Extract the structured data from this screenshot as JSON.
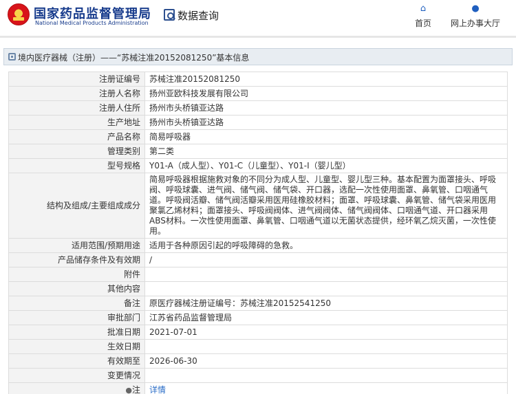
{
  "header": {
    "logo_cn": "国家药品监督管理局",
    "logo_en": "National Medical Products Administration",
    "module_title": "数据查询",
    "nav": [
      {
        "label": "首页",
        "icon": "home-icon"
      },
      {
        "label": "网上办事大厅",
        "icon": "user-icon"
      }
    ]
  },
  "breadcrumb": {
    "text": "境内医疗器械（注册）——“苏械注准20152081250”基本信息"
  },
  "details": {
    "rows": [
      {
        "label": "注册证编号",
        "value": "苏械注准20152081250"
      },
      {
        "label": "注册人名称",
        "value": "扬州亚欧科技发展有限公司"
      },
      {
        "label": "注册人住所",
        "value": "扬州市头桥镇亚达路"
      },
      {
        "label": "生产地址",
        "value": "扬州市头桥镇亚达路"
      },
      {
        "label": "产品名称",
        "value": "简易呼吸器"
      },
      {
        "label": "管理类别",
        "value": "第二类"
      },
      {
        "label": "型号规格",
        "value": "Y01-A（成人型）、Y01-C（儿童型）、Y01-I（婴儿型）"
      },
      {
        "label": "结构及组成/主要组成成分",
        "value": "简易呼吸器根据施救对象的不同分为成人型、儿童型、婴儿型三种。基本配置为面罩接头、呼吸阀、呼吸球囊、进气阀、储气阀、储气袋、开口器，选配一次性使用面罩、鼻氧管、口咽通气道。呼吸阀活瓣、储气阀活瓣采用医用硅橡胶材料；面罩、呼吸球囊、鼻氧管、储气袋采用医用聚氯乙烯材料；面罩接头、呼吸阀阀体、进气阀阀体、储气阀阀体、口咽通气道、开口器采用ABS材料。一次性使用面罩、鼻氧管、口咽通气道以无菌状态提供，经环氧乙烷灭菌，一次性使用。"
      },
      {
        "label": "适用范围/预期用途",
        "value": "适用于各种原因引起的呼吸障碍的急救。"
      },
      {
        "label": "产品储存条件及有效期",
        "value": "/"
      },
      {
        "label": "附件",
        "value": ""
      },
      {
        "label": "其他内容",
        "value": ""
      },
      {
        "label": "备注",
        "value": "原医疗器械注册证编号：苏械注准20152541250"
      },
      {
        "label": "审批部门",
        "value": "江苏省药品监督管理局"
      },
      {
        "label": "批准日期",
        "value": "2021-07-01"
      },
      {
        "label": "生效日期",
        "value": ""
      },
      {
        "label": "有效期至",
        "value": "2026-06-30"
      },
      {
        "label": "变更情况",
        "value": ""
      }
    ],
    "note": {
      "label": "注",
      "link": "详情"
    }
  }
}
